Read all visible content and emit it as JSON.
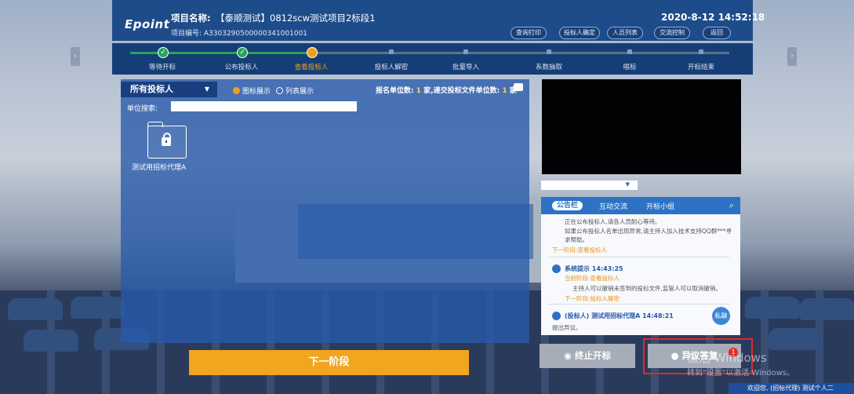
{
  "header": {
    "logo": "Epoint",
    "project_name_label": "项目名称:",
    "project_name_value": "【泰顺测试】0812scw测试项目2标段1",
    "project_code": "项目编号: A3303290500000341001001",
    "datetime": "2020-8-12   14:52:18",
    "buttons": [
      "查询打印",
      "投标人确定",
      "人员列表",
      "交流控制",
      "返回"
    ]
  },
  "progress": {
    "steps": [
      {
        "label": "等待开标",
        "state": "done"
      },
      {
        "label": "公布投标人",
        "state": "done"
      },
      {
        "label": "查看投标人",
        "state": "current"
      },
      {
        "label": "投标人解密",
        "state": "todo"
      },
      {
        "label": "批量导入",
        "state": "todo"
      },
      {
        "label": "系数抽取",
        "state": "todo"
      },
      {
        "label": "唱标",
        "state": "todo"
      },
      {
        "label": "开标结束",
        "state": "todo"
      }
    ],
    "done_color": "#27a35b",
    "current_color": "#f0a020"
  },
  "panel": {
    "title": "所有投标人",
    "view_icon": "图标展示",
    "view_list": "列表展示",
    "stats_prefix": "报名单位数:",
    "stats_signup": "1",
    "stats_mid": "家,递交投标文件单位数:",
    "stats_submitted": "1",
    "stats_suffix": "家",
    "search_label": "单位搜索:",
    "search_value": "",
    "bidder": "测试用招标代理A",
    "next_button": "下一阶段"
  },
  "chat": {
    "tabs": [
      "公告栏",
      "互动交流",
      "开标小组"
    ],
    "messages": [
      {
        "text1": "正在公布投标人,请各人员耐心等待。",
        "text2": "如果公布投标人名单出现异常,请主持人加入技术支持QQ群***寻求帮助。",
        "link": "下一阶段:查看投标人"
      },
      {
        "name": "系统提示 14:43:25",
        "link_top": "当前阶段:查看投标人",
        "text": "主持人可以撤销未签到的投标文件,监管人可以取消撤销。",
        "link": "下一阶段:投标人解密"
      },
      {
        "name": "(投标人)  测试用招标代理A 14:48:21",
        "text": "提出异议。"
      }
    ],
    "private_label": "私聊"
  },
  "actions": {
    "stop": "终止开标",
    "objection": "异议答复",
    "objection_badge": "1"
  },
  "system": {
    "watermark_line1": "激活 Windows",
    "watermark_line2": "转到\"设置\"以激活 Windows。",
    "welcome": "欢迎您, (招标代理) 测试个人二"
  }
}
